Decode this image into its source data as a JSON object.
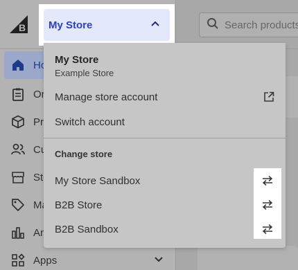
{
  "header": {
    "store_label": "My Store",
    "search_placeholder": "Search products"
  },
  "sidebar": {
    "items": [
      {
        "label": "Home",
        "icon": "home-icon",
        "active": true
      },
      {
        "label": "Orders",
        "icon": "clipboard-icon"
      },
      {
        "label": "Products",
        "icon": "box-icon"
      },
      {
        "label": "Customers",
        "icon": "users-icon"
      },
      {
        "label": "Storefront",
        "icon": "storefront-icon"
      },
      {
        "label": "Marketing",
        "icon": "tag-icon"
      },
      {
        "label": "Analytics",
        "icon": "bar-chart-icon"
      },
      {
        "label": "Apps",
        "icon": "apps-icon"
      }
    ]
  },
  "dropdown": {
    "current_store": "My Store",
    "current_store_subtitle": "Example Store",
    "manage_label": "Manage store account",
    "switch_label": "Switch account",
    "change_store_heading": "Change store",
    "stores": [
      {
        "name": "My Store Sandbox"
      },
      {
        "name": "B2B Store"
      },
      {
        "name": "B2B Sandbox"
      }
    ]
  },
  "colors": {
    "accent": "#2a3fc2",
    "trigger_bg": "#e4e8fb",
    "highlight": "#ffffff"
  }
}
